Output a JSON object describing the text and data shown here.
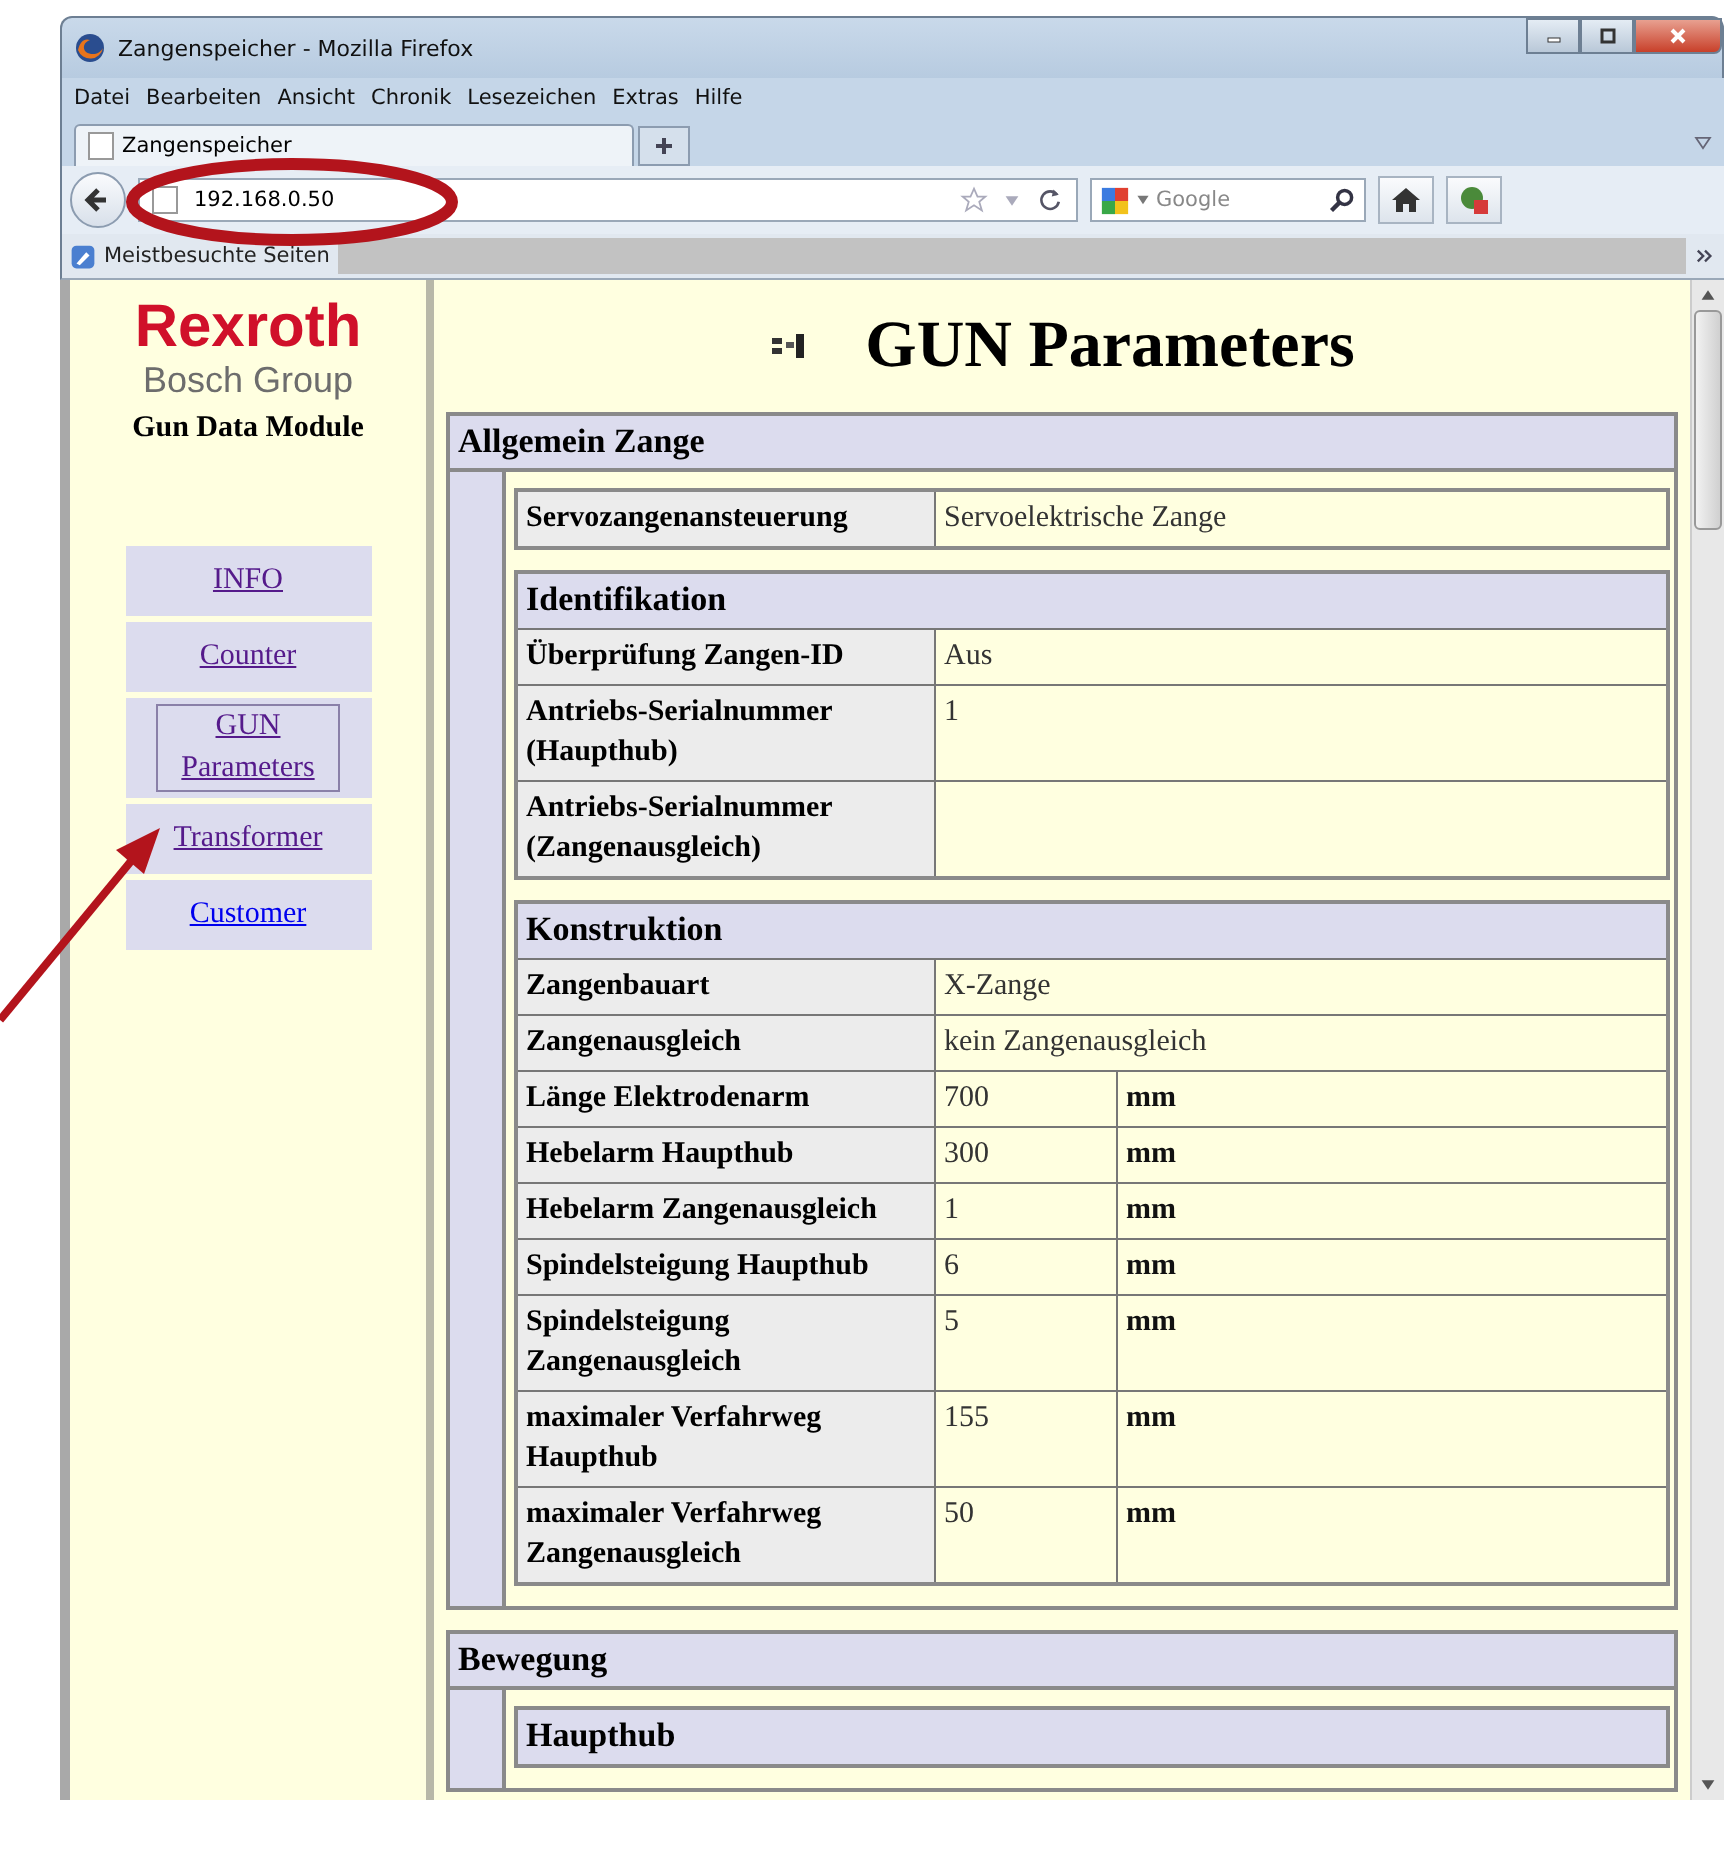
{
  "window": {
    "title": "Zangenspeicher - Mozilla Firefox"
  },
  "menu": [
    "Datei",
    "Bearbeiten",
    "Ansicht",
    "Chronik",
    "Lesezeichen",
    "Extras",
    "Hilfe"
  ],
  "tabs": [
    {
      "label": "Zangenspeicher",
      "selected": true
    }
  ],
  "address_bar": {
    "value": "192.168.0.50"
  },
  "search": {
    "placeholder": "Google"
  },
  "bookmarks": [
    "Meistbesuchte Seiten"
  ],
  "sidebar": {
    "brand": "Rexroth",
    "subbrand": "Bosch Group",
    "module": "Gun Data Module",
    "items": [
      {
        "label": "INFO",
        "selected": false,
        "visited": true
      },
      {
        "label": "Counter",
        "selected": false,
        "visited": true
      },
      {
        "label": "GUN Parameters",
        "selected": true,
        "visited": true
      },
      {
        "label": "Transformer",
        "selected": false,
        "visited": true
      },
      {
        "label": "Customer",
        "selected": false,
        "visited": false
      }
    ]
  },
  "page": {
    "title": "GUN Parameters",
    "sections": [
      {
        "title": "Allgemein Zange",
        "subsections": [
          {
            "rows": [
              {
                "label": "Servozangenansteuerung",
                "value": "Servoelektrische Zange"
              }
            ]
          },
          {
            "title": "Identifikation",
            "rows": [
              {
                "label": "Überprüfung Zangen-ID",
                "value": "Aus"
              },
              {
                "label": "Antriebs-Serialnummer (Haupthub)",
                "value": "1"
              },
              {
                "label": "Antriebs-Serialnummer (Zangenausgleich)"
              }
            ]
          },
          {
            "title": "Konstruktion",
            "rows": [
              {
                "label": "Zangenbauart",
                "value": "X-Zange"
              },
              {
                "label": "Zangenausgleich",
                "value": "kein Zangenausgleich"
              },
              {
                "label": "Länge Elektrodenarm",
                "value": "700",
                "unit": "mm"
              },
              {
                "label": "Hebelarm Haupthub",
                "value": "300",
                "unit": "mm"
              },
              {
                "label": "Hebelarm Zangenausgleich",
                "value": "1",
                "unit": "mm"
              },
              {
                "label": "Spindelsteigung Haupthub",
                "value": "6",
                "unit": "mm"
              },
              {
                "label": "Spindelsteigung Zangenausgleich",
                "value": "5",
                "unit": "mm"
              },
              {
                "label": "maximaler Verfahrweg Haupthub",
                "value": "155",
                "unit": "mm"
              },
              {
                "label": "maximaler Verfahrweg Zangenausgleich",
                "value": "50",
                "unit": "mm"
              }
            ]
          }
        ]
      },
      {
        "title": "Bewegung",
        "subsections": [
          {
            "title": "Haupthub"
          }
        ]
      }
    ]
  }
}
